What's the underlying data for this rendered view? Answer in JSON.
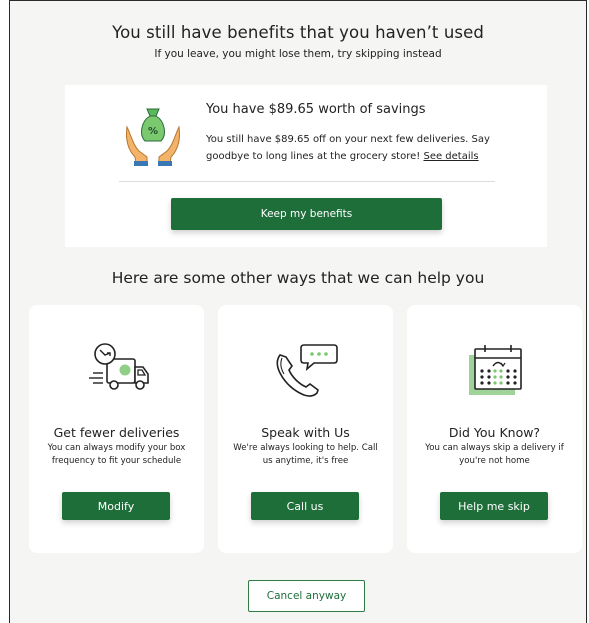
{
  "header": {
    "title": "You still have benefits that you haven’t used",
    "subtitle": "If you leave, you might lose them, try skipping instead"
  },
  "savings": {
    "title": "You have $89.65 worth of savings",
    "text": "You still have $89.65 off on your next few deliveries. Say goodbye to long lines at the grocery store! ",
    "details_link": "See details",
    "icon": "money-bag-hands-icon",
    "icon_symbol": "%",
    "keep_label": "Keep my benefits"
  },
  "help": {
    "title": "Here are some other ways that we can help you",
    "options": [
      {
        "icon": "delivery-truck-icon",
        "title": "Get fewer deliveries",
        "text": "You can always modify your box frequency to fit your schedule",
        "button": "Modify"
      },
      {
        "icon": "phone-chat-icon",
        "title": "Speak with Us",
        "text": "We're always looking to help. Call us anytime, it's free",
        "button": "Call us"
      },
      {
        "icon": "calendar-skip-icon",
        "title": "Did You Know?",
        "text": "You can always skip a delivery if you're not home",
        "button": "Help me skip"
      }
    ]
  },
  "cancel_label": "Cancel anyway",
  "colors": {
    "primary": "#1e6e3a",
    "accent_light": "#9fd39a",
    "background": "#f5f5f3",
    "card": "#ffffff"
  }
}
